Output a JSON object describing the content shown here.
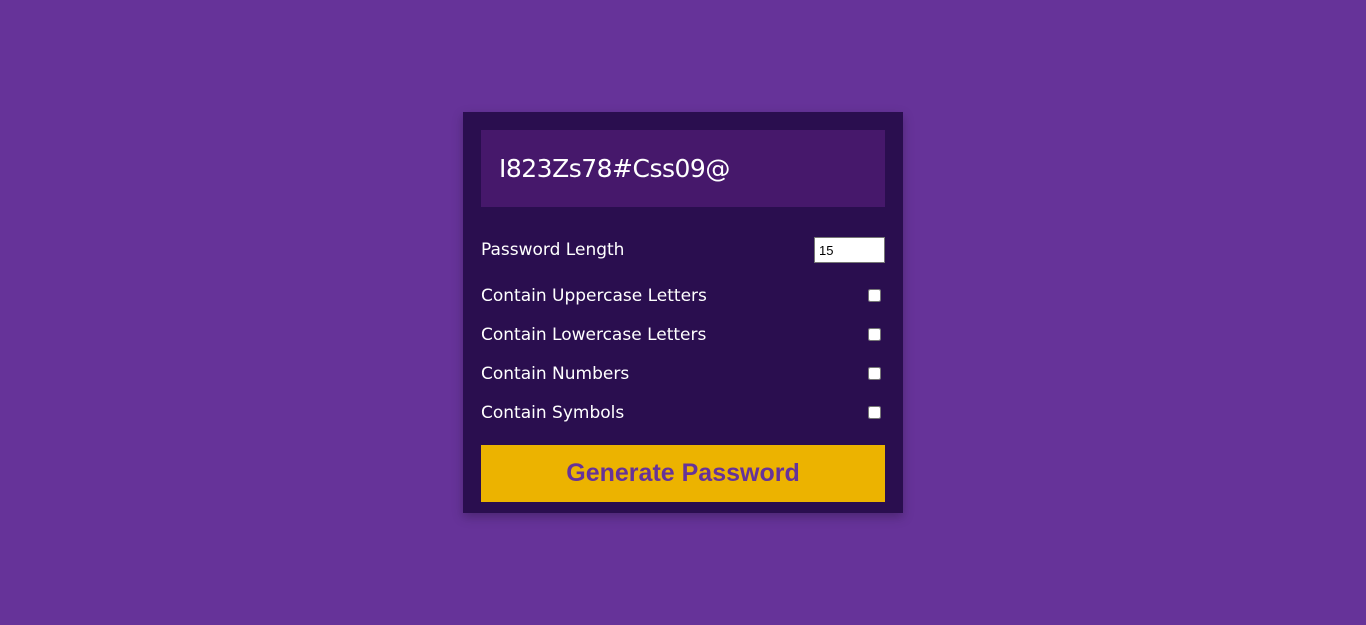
{
  "colors": {
    "page_background": "#663399",
    "card_background": "#2a0e4f",
    "result_background": "#46186b",
    "button_background": "#ecb300",
    "button_text": "#663399"
  },
  "result": {
    "password": "I823Zs78#Css09@"
  },
  "settings": {
    "length": {
      "label": "Password Length",
      "value": "15"
    },
    "uppercase": {
      "label": "Contain Uppercase Letters",
      "checked": false
    },
    "lowercase": {
      "label": "Contain Lowercase Letters",
      "checked": false
    },
    "numbers": {
      "label": "Contain Numbers",
      "checked": false
    },
    "symbols": {
      "label": "Contain Symbols",
      "checked": false
    }
  },
  "generate_button": {
    "label": "Generate Password"
  }
}
